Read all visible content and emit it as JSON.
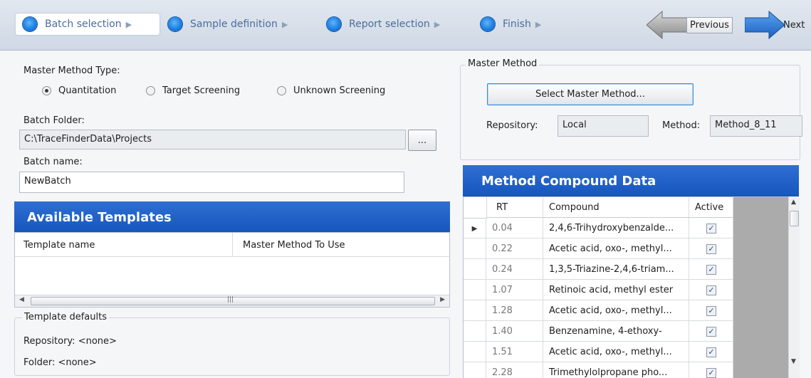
{
  "wizard": {
    "steps": [
      {
        "label": "Batch selection",
        "active": true
      },
      {
        "label": "Sample definition",
        "active": false
      },
      {
        "label": "Report selection",
        "active": false
      },
      {
        "label": "Finish",
        "active": false
      }
    ],
    "previous_label": "Previous",
    "next_label": "Next"
  },
  "left": {
    "method_type_label": "Master Method Type:",
    "method_types": [
      "Quantitation",
      "Target Screening",
      "Unknown Screening"
    ],
    "selected_method_type": "Quantitation",
    "batch_folder_label": "Batch Folder:",
    "batch_folder_value": "C:\\TraceFinderData\\Projects",
    "browse_label": "...",
    "batch_name_label": "Batch name:",
    "batch_name_value": "NewBatch",
    "templates_title": "Available Templates",
    "templates_columns": [
      "Template name",
      "Master Method To Use"
    ],
    "defaults_title": "Template defaults",
    "defaults_repository": "Repository: <none>",
    "defaults_folder": "Folder: <none>"
  },
  "right": {
    "group_title": "Master Method",
    "select_button": "Select Master Method...",
    "repository_label": "Repository:",
    "repository_value": "Local",
    "method_label": "Method:",
    "method_value": "Method_8_11",
    "compound_title": "Method Compound Data",
    "columns": [
      "RT",
      "Compound",
      "Active"
    ],
    "rows": [
      {
        "rt": "0.04",
        "compound": "2,4,6-Trihydroxybenzalde...",
        "active": true
      },
      {
        "rt": "0.22",
        "compound": "Acetic acid, oxo-, methyl...",
        "active": true
      },
      {
        "rt": "0.24",
        "compound": "1,3,5-Triazine-2,4,6-triam...",
        "active": true
      },
      {
        "rt": "1.07",
        "compound": "Retinoic acid, methyl ester",
        "active": true
      },
      {
        "rt": "1.28",
        "compound": "Acetic acid, oxo-, methyl...",
        "active": true
      },
      {
        "rt": "1.40",
        "compound": "Benzenamine, 4-ethoxy-",
        "active": true
      },
      {
        "rt": "1.51",
        "compound": "Acetic acid, oxo-, methyl...",
        "active": true
      },
      {
        "rt": "2.28",
        "compound": "Trimethylolpropane pho...",
        "active": true
      }
    ]
  }
}
